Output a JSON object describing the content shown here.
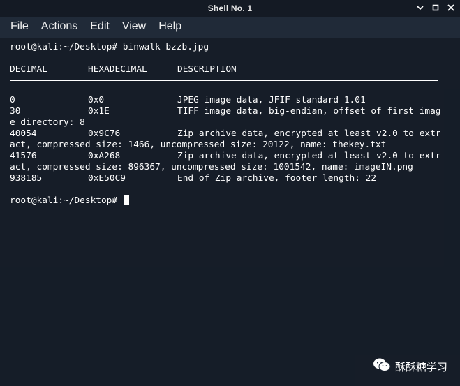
{
  "window": {
    "title": "Shell No. 1"
  },
  "menubar": [
    "File",
    "Actions",
    "Edit",
    "View",
    "Help"
  ],
  "terminal": {
    "prompt1": "root@kali:~/Desktop# binwalk bzzb.jpg",
    "headers": [
      "DECIMAL",
      "HEXADECIMAL",
      "DESCRIPTION"
    ],
    "dashes": "---",
    "rows": [
      {
        "dec": "0",
        "hex": "0x0",
        "desc": "JPEG image data, JFIF standard 1.01"
      },
      {
        "dec": "30",
        "hex": "0x1E",
        "desc": "TIFF image data, big-endian, offset of first image directory: 8"
      },
      {
        "dec": "40054",
        "hex": "0x9C76",
        "desc": "Zip archive data, encrypted at least v2.0 to extract, compressed size: 1466, uncompressed size: 20122, name: thekey.txt"
      },
      {
        "dec": "41576",
        "hex": "0xA268",
        "desc": "Zip archive data, encrypted at least v2.0 to extract, compressed size: 896367, uncompressed size: 1001542, name: imageIN.png"
      },
      {
        "dec": "938185",
        "hex": "0xE50C9",
        "desc": "End of Zip archive, footer length: 22"
      }
    ],
    "prompt2": "root@kali:~/Desktop#"
  },
  "watermark": {
    "text": "酥酥糖学习",
    "icon": "wechat-icon"
  }
}
